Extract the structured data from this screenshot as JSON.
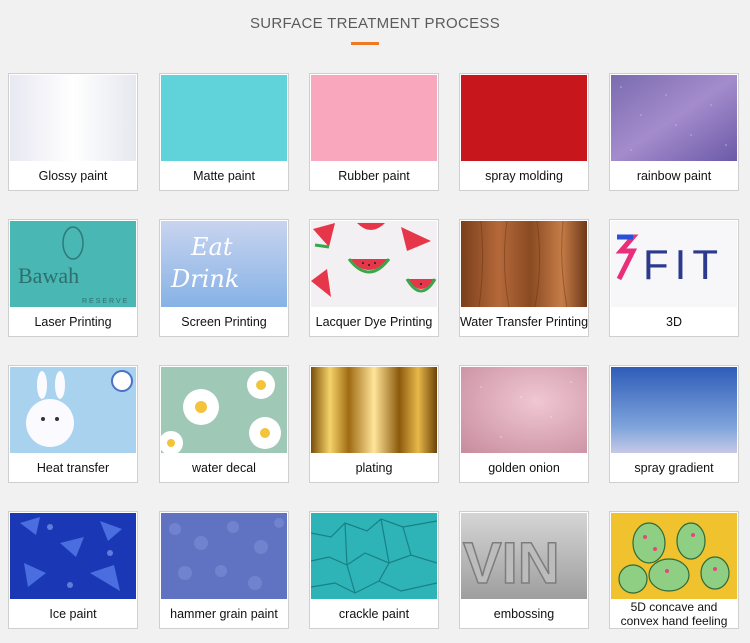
{
  "page": {
    "title": "SURFACE TREATMENT PROCESS",
    "accent_color": "#f07a24"
  },
  "grid": {
    "rows": [
      [
        {
          "label": "Glossy paint",
          "swatch": "glossy-white"
        },
        {
          "label": "Matte paint",
          "swatch": "matte-cyan"
        },
        {
          "label": "Rubber paint",
          "swatch": "rubber-pink"
        },
        {
          "label": "spray molding",
          "swatch": "spray-red"
        },
        {
          "label": "rainbow paint",
          "swatch": "rainbow-purple"
        }
      ],
      [
        {
          "label": "Laser Printing",
          "swatch": "laser-teal",
          "art_text": [
            "Bawah",
            "RESERVE"
          ]
        },
        {
          "label": "Screen Printing",
          "swatch": "screen-script",
          "art_text": [
            "Eat",
            "Drink"
          ]
        },
        {
          "label": "Lacquer Dye Printing",
          "swatch": "watermelon"
        },
        {
          "label": "Water Transfer Printing",
          "swatch": "woodgrain"
        },
        {
          "label": "3D",
          "swatch": "fit-3d",
          "art_text": [
            "FIT"
          ]
        }
      ],
      [
        {
          "label": "Heat transfer",
          "swatch": "rabbit"
        },
        {
          "label": "water decal",
          "swatch": "daisy"
        },
        {
          "label": "plating",
          "swatch": "gold-plating"
        },
        {
          "label": "golden onion",
          "swatch": "pink-glitter"
        },
        {
          "label": "spray gradient",
          "swatch": "blue-gradient"
        }
      ],
      [
        {
          "label": "Ice paint",
          "swatch": "ice-blue"
        },
        {
          "label": "hammer grain paint",
          "swatch": "hammer-blue"
        },
        {
          "label": "crackle paint",
          "swatch": "crackle-teal"
        },
        {
          "label": "embossing",
          "swatch": "emboss-vin",
          "art_text": [
            "VIN"
          ]
        },
        {
          "label": "5D concave and convex hand feeling",
          "swatch": "cactus"
        }
      ]
    ]
  }
}
